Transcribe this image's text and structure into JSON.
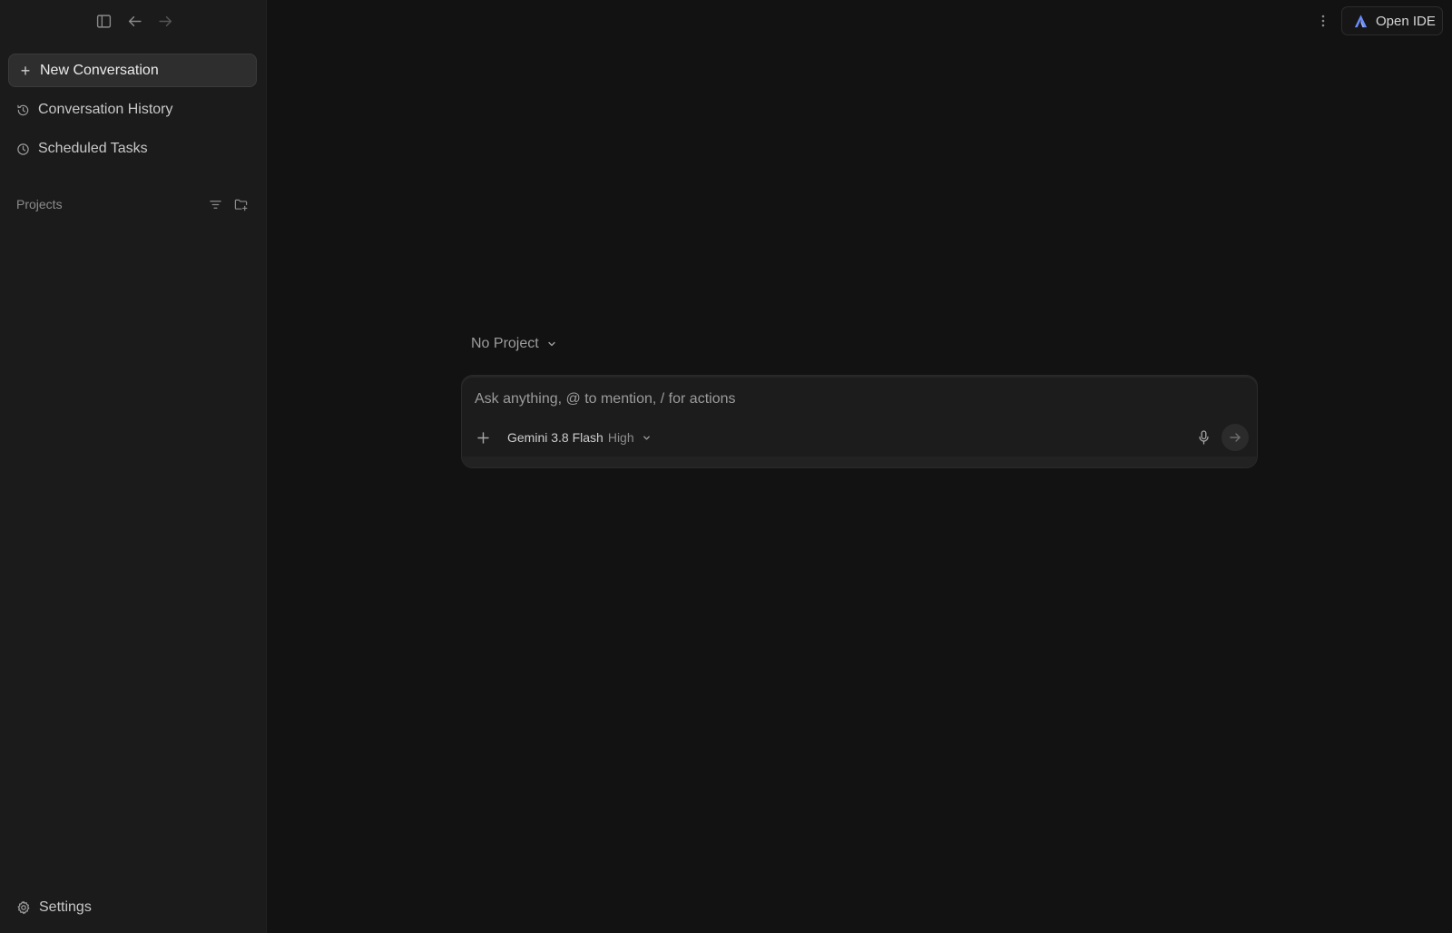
{
  "sidebar": {
    "new_conversation": "New Conversation",
    "items": [
      {
        "label": "Conversation History",
        "icon": "history-icon"
      },
      {
        "label": "Scheduled Tasks",
        "icon": "clock-icon"
      }
    ],
    "projects_title": "Projects",
    "settings_label": "Settings"
  },
  "header": {
    "open_ide_label": "Open IDE"
  },
  "main": {
    "project_select": "No Project",
    "composer": {
      "placeholder": "Ask anything, @ to mention, / for actions",
      "model_name": "Gemini 3.8 Flash",
      "model_effort": "High"
    }
  },
  "colors": {
    "background": "#121212",
    "sidebar": "#1b1b1b",
    "accent_logo": "#6b8cff"
  }
}
